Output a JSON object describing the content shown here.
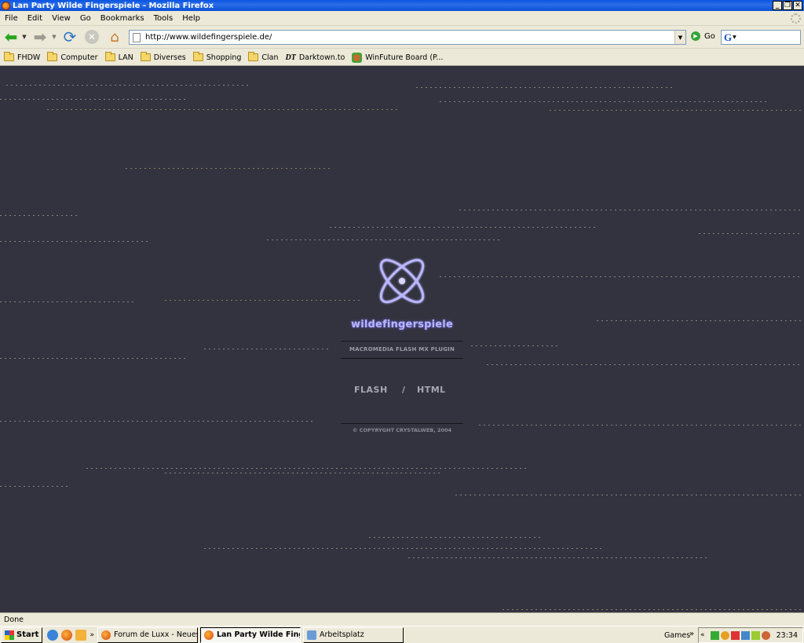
{
  "window": {
    "title": "Lan Party Wilde Fingerspiele - Mozilla Firefox",
    "minimize": "_",
    "restore": "❐",
    "close": "✕"
  },
  "menu": [
    "File",
    "Edit",
    "View",
    "Go",
    "Bookmarks",
    "Tools",
    "Help"
  ],
  "toolbar": {
    "url": "http://www.wildefingerspiele.de/",
    "go_label": "Go",
    "search_engine_glyph": "G",
    "icons": {
      "back": "arrow-left-icon",
      "forward": "arrow-right-icon",
      "reload": "reload-icon",
      "stop": "stop-icon",
      "home": "home-icon"
    }
  },
  "bookmarks": [
    {
      "label": "FHDW",
      "icon": "folder"
    },
    {
      "label": "Computer",
      "icon": "folder"
    },
    {
      "label": "LAN",
      "icon": "folder"
    },
    {
      "label": "Diverses",
      "icon": "folder"
    },
    {
      "label": "Shopping",
      "icon": "folder"
    },
    {
      "label": "Clan",
      "icon": "folder"
    },
    {
      "label": "Darktown.to",
      "icon": "dt"
    },
    {
      "label": "WinFuture Board (P...",
      "icon": "wf"
    }
  ],
  "site": {
    "name": "wildefingerspiele",
    "plugin": "MACROMEDIA FLASH MX PLUGIN",
    "flash_link": "FLASH",
    "separator": "/",
    "html_link": "HTML",
    "copyright": "© COPYRYGHT CRYSTALWEB, 2004",
    "colors": {
      "background": "#33333f",
      "logo": "#b9b6ff",
      "text": "#a7a7b2"
    }
  },
  "status": {
    "text": "Done"
  },
  "taskbar": {
    "start_label": "Start",
    "tasks": [
      {
        "label": "Forum de Luxx - Neues T...",
        "active": false
      },
      {
        "label": "Lan Party Wilde Finge...",
        "active": true
      },
      {
        "label": "Arbeitsplatz",
        "active": false
      }
    ],
    "games_label": "Games",
    "chevron": "»",
    "clock": "23:34"
  }
}
